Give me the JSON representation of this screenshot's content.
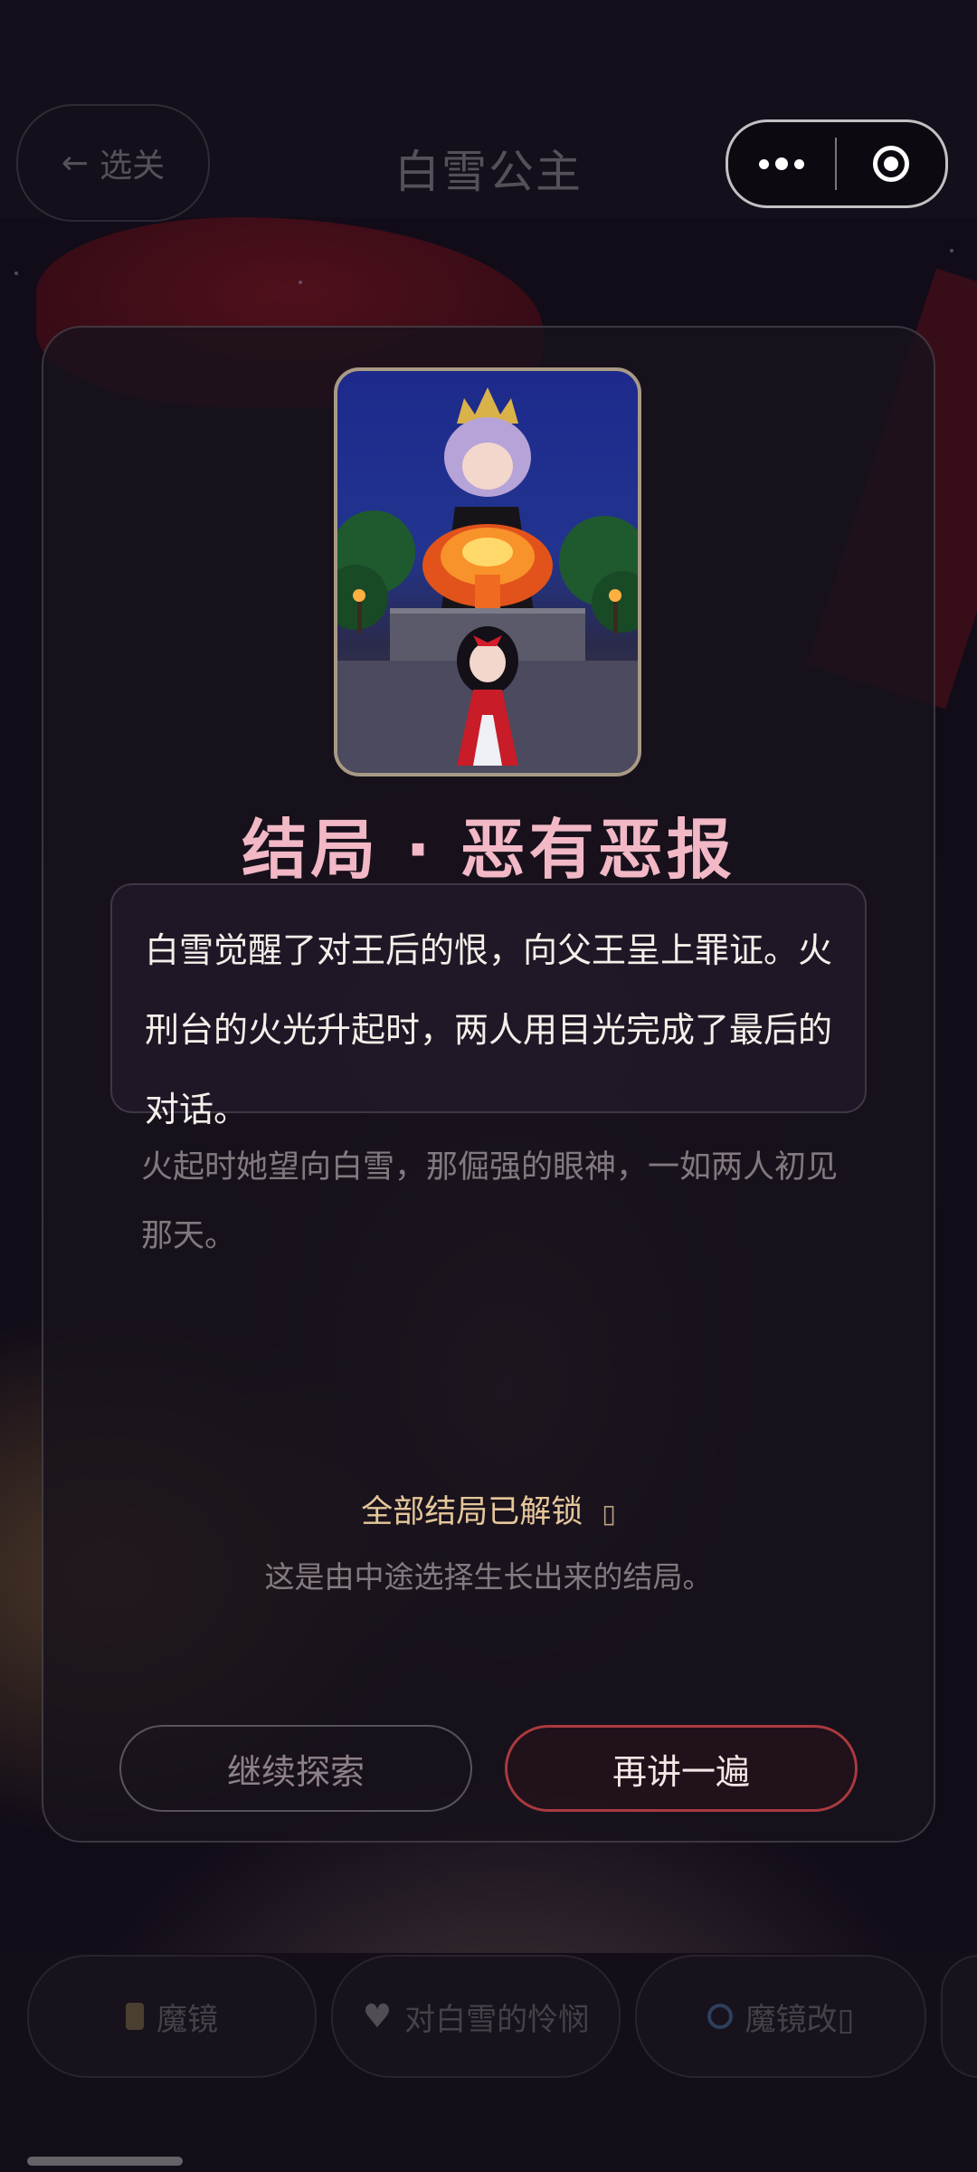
{
  "header": {
    "back_label": "选关",
    "title": "白雪公主"
  },
  "ending": {
    "image_alt": "王后站在火刑台前，烈焰升起，白雪站在台下",
    "title": "结局 · 恶有恶报",
    "description": "白雪觉醒了对王后的恨，向父王呈上罪证。火刑台的火光升起时，两人用目光完成了最后的对话。",
    "extra": "火起时她望向白雪，那倔强的眼神，一如两人初见那天。",
    "unlocked_label": "全部结局已解锁",
    "unlocked_icon": "▯",
    "subnote": "这是由中途选择生长出来的结局。"
  },
  "buttons": {
    "continue_label": "继续探索",
    "again_label": "再讲一遍"
  },
  "bottom_bar": {
    "chips": [
      {
        "icon": "mirror-icon",
        "label": "魔镜"
      },
      {
        "icon": "heart-icon",
        "label": "对白雪的怜悯"
      },
      {
        "icon": "swirl-icon",
        "label": "魔镜改▯"
      }
    ]
  },
  "colors": {
    "title_pink": "#f2b8c6",
    "accent_red": "#a93a3e",
    "gold": "#e6c79a"
  }
}
